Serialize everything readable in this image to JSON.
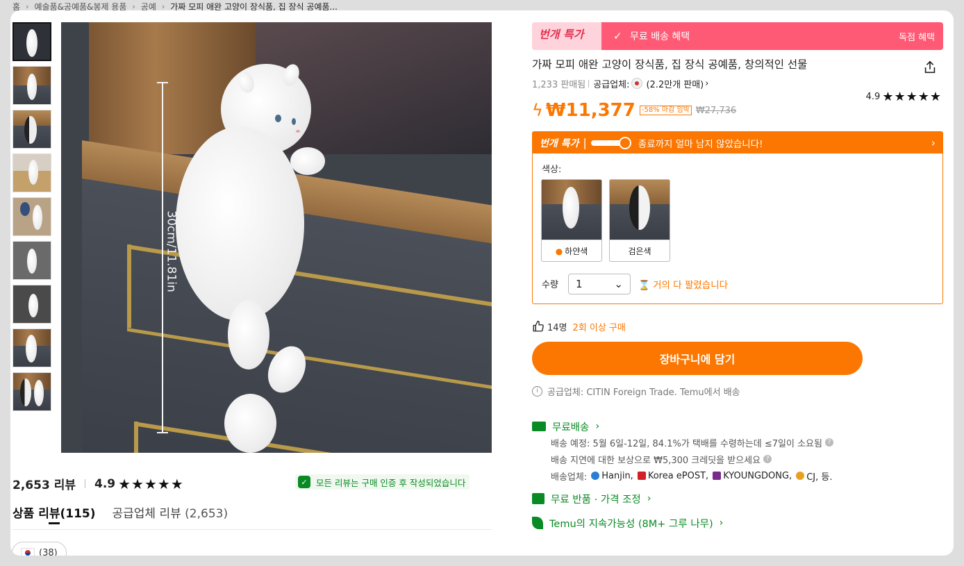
{
  "breadcrumb": {
    "items": [
      "홈",
      "예술품&공예품&봉제 용품",
      "공예",
      "가짜 모피 애완 고양이 장식품, 집 장식 공예품..."
    ]
  },
  "gallery": {
    "measure_label": "30cm/11.81in"
  },
  "reviews": {
    "count": "2,653 리뷰",
    "rating": "4.9",
    "stars": "★★★★★",
    "verified_note": "모든 리뷰는 구매 인증 후 작성되었습니다",
    "tab_product": "상품 리뷰",
    "tab_product_count": "(115)",
    "tab_supplier": "공급업체 리뷰",
    "tab_supplier_count": "(2,653)",
    "country_count": "(38)"
  },
  "promo": {
    "flash_label": "번개 특가",
    "shipping": "무료 배송 혜택",
    "exclusive": "독점 혜택"
  },
  "product": {
    "title": "가짜 모피 애완 고양이 장식품, 집 장식 공예품, 창의적인 선물",
    "sold": "1,233 판매됨",
    "supplier_label": "공급업체:",
    "supplier_sales": "(2.2만개 판매)",
    "rating": "4.9",
    "stars": "★★★★★"
  },
  "price": {
    "current": "₩11,377",
    "discount": "-58% 마감 임박",
    "original": "₩27,736"
  },
  "flash_deal": {
    "title": "번개 특가",
    "message": "종료까지 얼마 남지 않았습니다!",
    "color_label": "색상:",
    "colors": [
      {
        "label": "하얀색"
      },
      {
        "label": "검은색"
      }
    ],
    "qty_label": "수량",
    "qty_value": "1",
    "stock_warning": "거의 다 팔렸습니다"
  },
  "social": {
    "count": "14명",
    "repeat": "2회 이상 구매"
  },
  "cart_button": "장바구니에 담기",
  "supplier_note": "공급업체: CITIN Foreign Trade. Temu에서 배송",
  "shipping": {
    "title": "무료배송",
    "estimate": "배송 예정: 5월 6일-12일, 84.1%가 택배를 수령하는데 ≤7일이 소요됨",
    "delay": "배송 지연에 대한 보상으로 ₩5,300 크레딧을 받으세요",
    "carriers_label": "배송업체:",
    "carriers": [
      "Hanjin,",
      "Korea ePOST,",
      "KYOUNGDONG,",
      "CJ, 등."
    ],
    "carrier_colors": [
      "#2a7fd4",
      "#d41f26",
      "#7a2a8a",
      "#e8a020"
    ]
  },
  "returns": "무료 반품 · 가격 조정",
  "sustainability": "Temu의 지속가능성 (8M+ 그루 나무)",
  "colors": {
    "accent": "#fb7701",
    "green": "#0a8a24",
    "promo_pink": "#ff5a75"
  }
}
